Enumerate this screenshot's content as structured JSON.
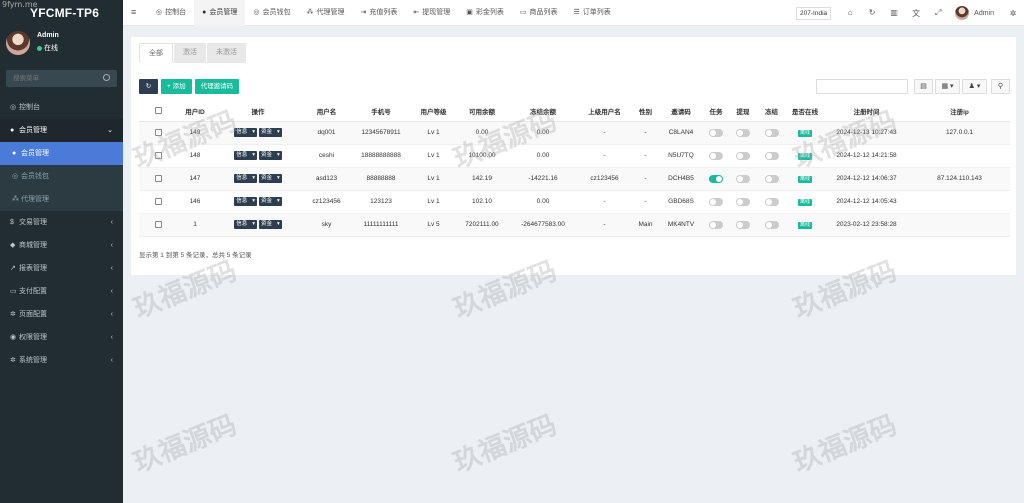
{
  "brand": "YFCMF-TP6",
  "corner_url": "9fym.me",
  "user": {
    "name": "Admin",
    "status": "在线"
  },
  "sidebar": {
    "search_placeholder": "搜索菜单",
    "items": [
      {
        "label": "控制台",
        "icon": "dashboard-icon",
        "glyph": "◎"
      },
      {
        "label": "会员管理",
        "icon": "user-icon",
        "glyph": "●",
        "chevron": "⌄"
      },
      {
        "label": "会员管理",
        "icon": "user-icon",
        "glyph": "●"
      },
      {
        "label": "会员钱包",
        "icon": "wallet-icon",
        "glyph": "◎"
      },
      {
        "label": "代理管理",
        "icon": "sitemap-icon",
        "glyph": "⁂"
      },
      {
        "label": "交易管理",
        "icon": "dollar-icon",
        "glyph": "$",
        "chevron": "‹"
      },
      {
        "label": "商城管理",
        "icon": "cart-icon",
        "glyph": "◆",
        "chevron": "‹"
      },
      {
        "label": "报表管理",
        "icon": "chart-icon",
        "glyph": "↗",
        "chevron": "‹"
      },
      {
        "label": "支付配置",
        "icon": "card-icon",
        "glyph": "▭",
        "chevron": "‹"
      },
      {
        "label": "页面配置",
        "icon": "gear-icon",
        "glyph": "✲",
        "chevron": "‹"
      },
      {
        "label": "权限管理",
        "icon": "users-icon",
        "glyph": "◉",
        "chevron": "‹"
      },
      {
        "label": "系统管理",
        "icon": "cogs-icon",
        "glyph": "✲",
        "chevron": "‹"
      }
    ]
  },
  "navbar": {
    "toggle": "≡",
    "tabs": [
      {
        "label": "控制台",
        "icon": "dashboard-icon",
        "glyph": "◎"
      },
      {
        "label": "会员管理",
        "icon": "user-icon",
        "glyph": "●"
      },
      {
        "label": "会员钱包",
        "icon": "wallet-icon",
        "glyph": "◎"
      },
      {
        "label": "代理管理",
        "icon": "sitemap-icon",
        "glyph": "⁂"
      },
      {
        "label": "充值列表",
        "icon": "login-icon",
        "glyph": "⇥"
      },
      {
        "label": "提现管理",
        "icon": "logout-icon",
        "glyph": "⇤"
      },
      {
        "label": "彩金列表",
        "icon": "gift-icon",
        "glyph": "▣"
      },
      {
        "label": "商品列表",
        "icon": "desktop-icon",
        "glyph": "▭"
      },
      {
        "label": "订单列表",
        "icon": "list-icon",
        "glyph": "☰"
      }
    ],
    "region": "207-India",
    "icons": [
      {
        "name": "home-icon",
        "glyph": "⌂"
      },
      {
        "name": "refresh-icon",
        "glyph": "↻"
      },
      {
        "name": "trash-icon",
        "glyph": "▥"
      },
      {
        "name": "language-icon",
        "glyph": "文"
      },
      {
        "name": "fullscreen-icon",
        "glyph": "⤢"
      }
    ],
    "admin": "Admin",
    "settings_glyph": "✲"
  },
  "page_tabs": [
    "全部",
    "激活",
    "未激活"
  ],
  "toolbar": {
    "refresh_glyph": "↻",
    "add_label": "+ 添加",
    "agent_label": "代理邀请码"
  },
  "right_toolbar": {
    "export_glyph": "▤",
    "columns_glyph": "▦ ▾",
    "toggle_glyph": "♟ ▾",
    "search_glyph": "⚲"
  },
  "table": {
    "headers": [
      "",
      "用户ID",
      "操作",
      "用户名",
      "手机号",
      "用户等级",
      "可用余额",
      "冻结余额",
      "上级用户名",
      "性别",
      "邀请码",
      "任务",
      "提现",
      "冻结",
      "是否在线",
      "注册时间",
      "注册ip"
    ],
    "info_label": "信息",
    "fund_label": "资金",
    "rows": [
      {
        "id": "149",
        "username": "dq001",
        "phone": "12345678911",
        "level": "Lv 1",
        "balance": "0.00",
        "frozen": "0.00",
        "parent": "-",
        "gender": "-",
        "code": "C8LAN4",
        "task": false,
        "withdraw": false,
        "freeze": false,
        "online": "离线",
        "regtime": "2024-12-13 10:27:43",
        "ip": "127.0.0.1"
      },
      {
        "id": "148",
        "username": "ceshi",
        "phone": "18888888888",
        "level": "Lv 1",
        "balance": "10100.00",
        "frozen": "0.00",
        "parent": "-",
        "gender": "-",
        "code": "N5U7TQ",
        "task": false,
        "withdraw": false,
        "freeze": false,
        "online": "离线",
        "regtime": "2024-12-12 14:21:58",
        "ip": ""
      },
      {
        "id": "147",
        "username": "asd123",
        "phone": "88888888",
        "level": "Lv 1",
        "balance": "142.19",
        "frozen": "-14221.16",
        "parent": "cz123456",
        "gender": "-",
        "code": "DCH4B5",
        "task": true,
        "withdraw": false,
        "freeze": false,
        "online": "离线",
        "regtime": "2024-12-12 14:06:37",
        "ip": "87.124.110.143"
      },
      {
        "id": "146",
        "username": "cz123456",
        "phone": "123123",
        "level": "Lv 1",
        "balance": "102.10",
        "frozen": "0.00",
        "parent": "-",
        "gender": "-",
        "code": "GBD68S",
        "task": false,
        "withdraw": false,
        "freeze": false,
        "online": "离线",
        "regtime": "2024-12-12 14:05:43",
        "ip": ""
      },
      {
        "id": "1",
        "username": "sky",
        "phone": "11111111111",
        "level": "Lv 5",
        "balance": "7202111.00",
        "frozen": "-264677583.00",
        "parent": "-",
        "gender": "Main",
        "code": "MK4NTV",
        "task": false,
        "withdraw": false,
        "freeze": false,
        "online": "离线",
        "regtime": "2023-02-12 23:58:28",
        "ip": ""
      }
    ]
  },
  "summary": "显示第 1 到第 5 条记录，总共 5 条记录",
  "watermark": "玖福源码"
}
